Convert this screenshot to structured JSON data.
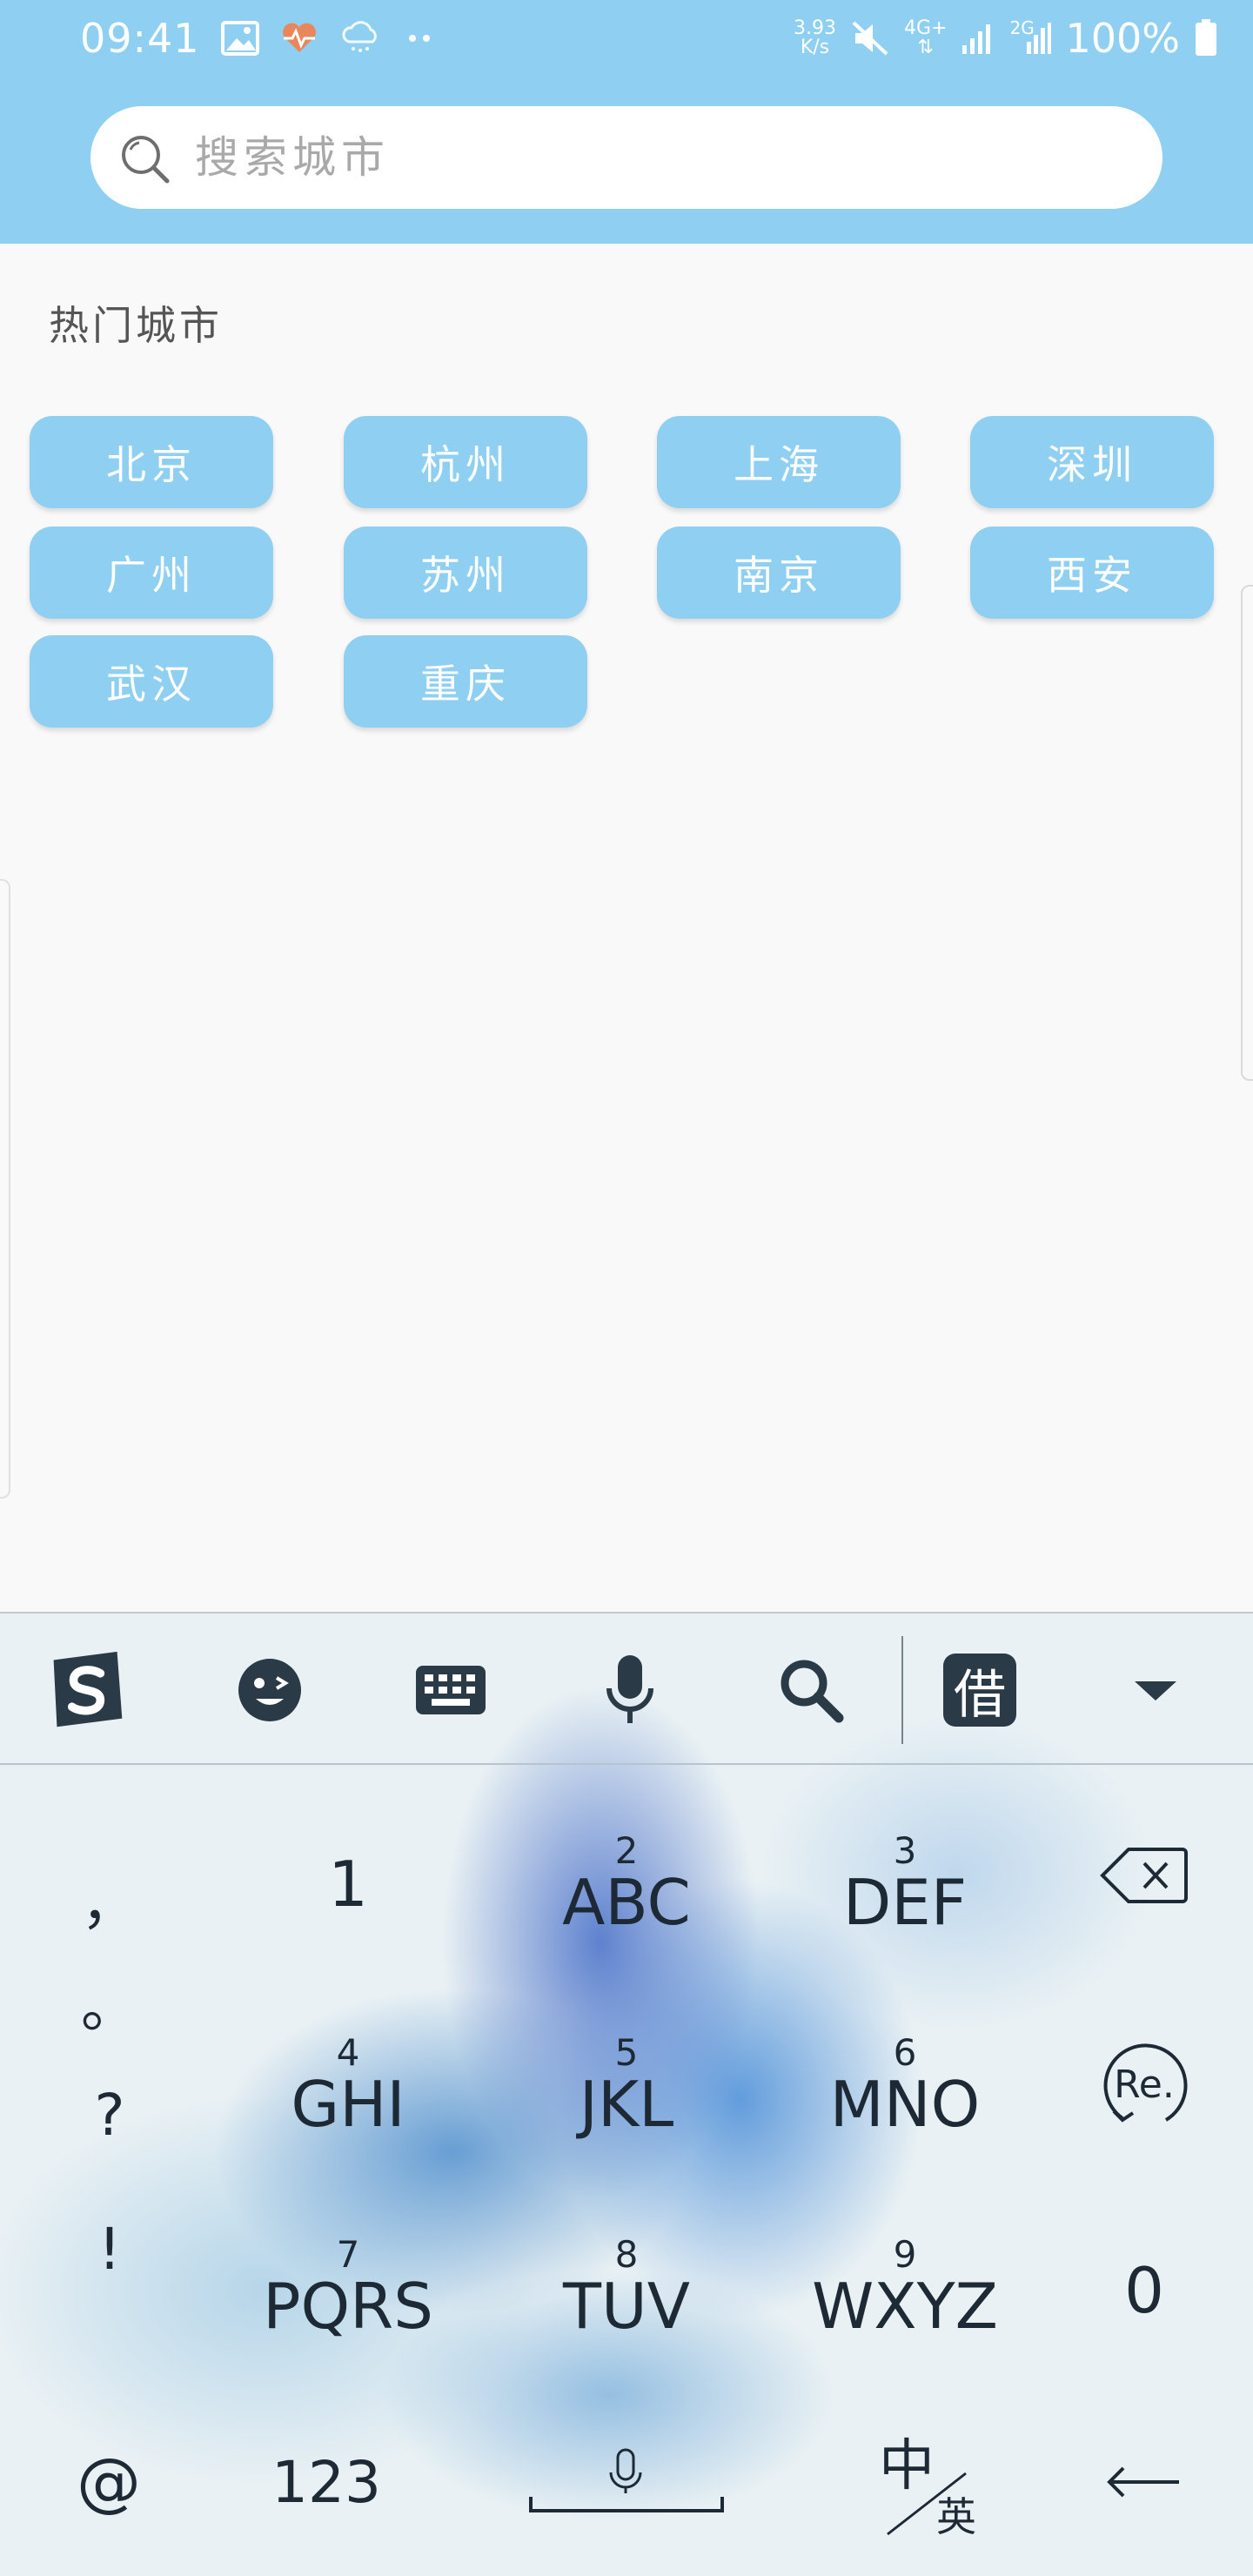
{
  "colors": {
    "accent": "#8fd0f2",
    "background": "#f9f9f9",
    "section_title": "#555555",
    "keyboard_text": "#1d2a35"
  },
  "status_bar": {
    "time": "09:41",
    "net_speed_value": "3.93",
    "net_speed_unit": "K/s",
    "net_4g": "4G+",
    "net_2g": "2G",
    "battery_percent": "100%",
    "icons": [
      "gallery-icon",
      "heart-rate-icon",
      "cloud-rain-icon",
      "more-dots-icon",
      "mute-icon",
      "signal-icon",
      "battery-icon"
    ]
  },
  "search": {
    "placeholder": "搜索城市",
    "value": ""
  },
  "hot_cities": {
    "title": "热门城市",
    "items": [
      "北京",
      "杭州",
      "上海",
      "深圳",
      "广州",
      "苏州",
      "南京",
      "西安",
      "武汉",
      "重庆"
    ]
  },
  "keyboard": {
    "toolbar_icons": [
      "sogou-logo-icon",
      "emoji-icon",
      "keyboard-icon",
      "microphone-icon",
      "search-icon",
      "borrow-icon",
      "collapse-icon"
    ],
    "borrow_label": "借",
    "punctuation": [
      "，",
      "。",
      "?",
      "!"
    ],
    "keys": [
      {
        "num": "",
        "letters": "1"
      },
      {
        "num": "2",
        "letters": "ABC"
      },
      {
        "num": "3",
        "letters": "DEF"
      },
      {
        "num": "4",
        "letters": "GHI"
      },
      {
        "num": "5",
        "letters": "JKL"
      },
      {
        "num": "6",
        "letters": "MNO"
      },
      {
        "num": "7",
        "letters": "PQRS"
      },
      {
        "num": "8",
        "letters": "TUV"
      },
      {
        "num": "9",
        "letters": "WXYZ"
      }
    ],
    "zero": "0",
    "reenter_label": "Re.",
    "bottom": {
      "at": "@",
      "numbers": "123",
      "lang_zh": "中",
      "lang_en": "英"
    }
  }
}
